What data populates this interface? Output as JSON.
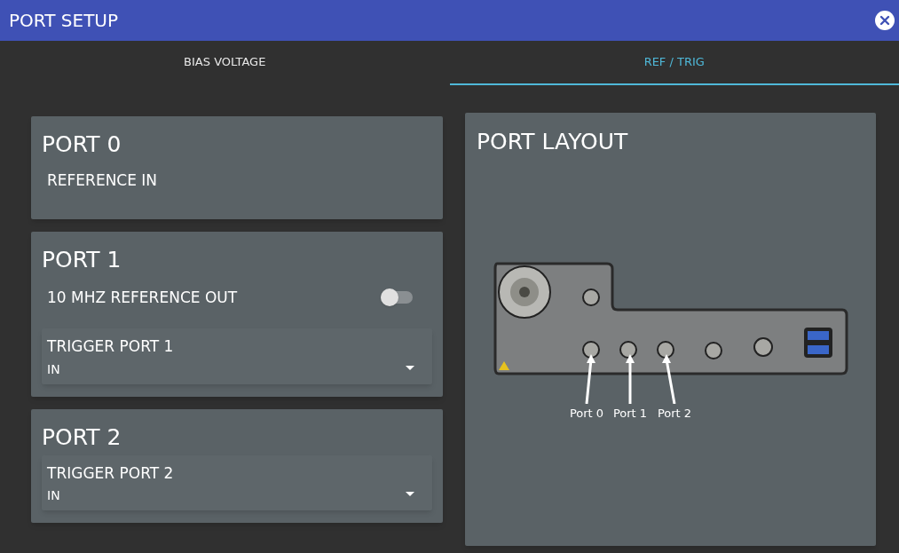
{
  "dialog": {
    "title": "PORT SETUP"
  },
  "tabs": [
    {
      "label": "BIAS VOLTAGE",
      "selected": false
    },
    {
      "label": "REF / TRIG",
      "selected": true
    }
  ],
  "ports": [
    {
      "title": "PORT 0",
      "items": [
        {
          "kind": "label",
          "text": "REFERENCE IN"
        }
      ]
    },
    {
      "title": "PORT 1",
      "items": [
        {
          "kind": "toggle",
          "text": "10 MHZ REFERENCE OUT",
          "on": false
        },
        {
          "kind": "dropdown",
          "label": "TRIGGER PORT 1",
          "value": "IN"
        }
      ]
    },
    {
      "title": "PORT 2",
      "items": [
        {
          "kind": "dropdown",
          "label": "TRIGGER PORT 2",
          "value": "IN"
        }
      ]
    }
  ],
  "layout": {
    "title": "PORT LAYOUT",
    "callouts": [
      {
        "label": "Port 0"
      },
      {
        "label": "Port 1"
      },
      {
        "label": "Port 2"
      }
    ]
  }
}
